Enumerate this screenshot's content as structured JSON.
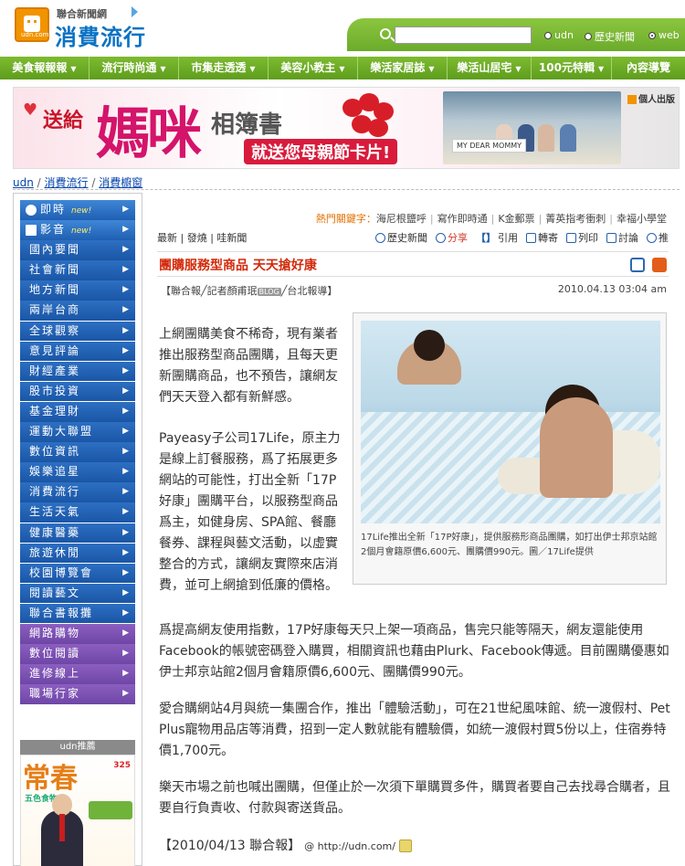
{
  "header": {
    "brand_top": "聯合新聞網",
    "brand_main": "消費流行",
    "logo_sub": "udn.com",
    "search": {
      "placeholder": "",
      "value": ""
    },
    "search_options": [
      {
        "label": "udn",
        "selected": false
      },
      {
        "label": "歷史新聞",
        "selected": false
      },
      {
        "label": "web",
        "selected": true
      }
    ]
  },
  "nav": {
    "items": [
      "美食報報報",
      "流行時尚通",
      "市集走透透",
      "美容小教主",
      "樂活家居誌",
      "樂活山居宅",
      "100元特輯",
      "內容導覽"
    ]
  },
  "banner": {
    "heart": "♥",
    "line1": "送給",
    "big": "媽咪",
    "line2": "相簿書",
    "sub": "就送您母親節卡片!",
    "card_text": "MY DEAR MOMMY",
    "publisher": "個人出版"
  },
  "breadcrumb": {
    "items": [
      "udn",
      "消費流行",
      "消費櫥窗"
    ],
    "sep": " / "
  },
  "sidebar": {
    "top_items": [
      {
        "label": "即時",
        "badge": "new!"
      },
      {
        "label": "影音",
        "badge": "new!"
      }
    ],
    "items": [
      "國內要聞",
      "社會新聞",
      "地方新聞",
      "兩岸台商",
      "全球觀察",
      "意見評論",
      "財經產業",
      "股市投資",
      "基金理財",
      "運動大聯盟",
      "數位資訊",
      "娛樂追星",
      "消費流行",
      "生活天氣",
      "健康醫藥",
      "旅遊休閒",
      "校園博覽會",
      "閱讀藝文",
      "聯合書報攤"
    ],
    "purple_items": [
      "網路購物",
      "數位閱讀",
      "進修線上",
      "職場行家"
    ],
    "recommend_head": "udn推薦",
    "magazine": {
      "title": "常春",
      "issue": "325",
      "sub": "五色食物"
    }
  },
  "article": {
    "hot_label": "熱門關鍵字：",
    "hot_keywords": [
      "海尼根鹽呼",
      "寫作即時通",
      "K金郵票",
      "菁英指考衝刺",
      "幸福小學堂"
    ],
    "tools_left": [
      "最新",
      "發燒",
      "哇新聞"
    ],
    "tools_right": [
      "歷史新聞",
      "分享",
      "引用",
      "轉寄",
      "列印",
      "討論",
      "推"
    ],
    "title": "團購服務型商品 天天搶好康",
    "byline": "【聯合報╱記者顏甫珉",
    "byline_blog": "BLOG",
    "byline_tail": "╱台北報導】",
    "date": "2010.04.13 03:04 am",
    "caption": "17Life推出全新「17P好康」，提供服務形商品團購，如打出伊士邦京站館2個月會籍原價6,600元、團購價990元。圖／17Life提供",
    "p1": "上網團購美食不稀奇，現有業者推出服務型商品團購，且每天更新團購商品，也不預告，讓網友們天天登入都有新鮮感。",
    "p2": "Payeasy子公司17Life，原主力是線上訂餐服務，爲了拓展更多網站的可能性，打出全新「17P好康」團購平台，以服務型商品爲主，如健身房、SPA館、餐廳餐券、課程與藝文活動，以虛實整合的方式，讓網友實際來店消費，並可上網搶到低廉的價格。",
    "p3": "爲提高網友使用指數，17P好康每天只上架一項商品，售完只能等隔天，網友還能使用Facebook的帳號密碼登入購買，相關資訊也藉由Plurk、Facebook傳遞。目前團購優惠如伊士邦京站館2個月會籍原價6,600元、團購價990元。",
    "p4": "愛合購網站4月與統一集團合作，推出「體驗活動」，可在21世紀風味館、統一渡假村、Pet Plus寵物用品店等消費，招到一定人數就能有體驗價，如統一渡假村買5份以上，住宿券特價1,700元。",
    "p5": "樂天市場之前也喊出團購，但僅止於一次須下單購買多件，購買者要自己去找尋合購者，且要自行負責收、付款與寄送貨品。",
    "source": "【2010/04/13 聯合報】",
    "source_url": "@ http://udn.com/"
  },
  "colors": {
    "nav_green": "#6bab2b",
    "menu_blue": "#1f5fb3",
    "menu_purple": "#6e46a6",
    "title_red": "#d22a0a",
    "keyword_orange": "#e07000"
  }
}
